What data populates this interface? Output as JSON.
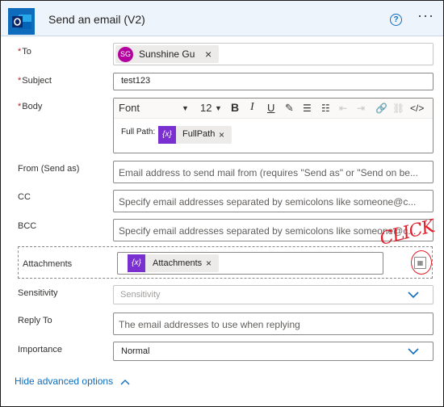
{
  "header": {
    "title": "Send an email (V2)",
    "help_icon": "help-circle-icon",
    "more_icon": "more-ellipsis-icon",
    "app_icon": "outlook-icon",
    "accent": "#0f6cbd"
  },
  "fields": {
    "to": {
      "label": "To",
      "required_mark": "*",
      "recipient": {
        "initials": "SG",
        "name": "Sunshine Gu"
      }
    },
    "subject": {
      "label": "Subject",
      "required_mark": "*",
      "value": "test123"
    },
    "body": {
      "label": "Body",
      "required_mark": "*",
      "font": "Font",
      "font_size": "12",
      "text": "Full Path:",
      "token": "FullPath",
      "token_symbol": "{x}"
    },
    "from": {
      "label": "From (Send as)",
      "placeholder": "Email address to send mail from (requires \"Send as\" or \"Send on be..."
    },
    "cc": {
      "label": "CC",
      "placeholder": "Specify email addresses separated by semicolons like someone@c..."
    },
    "bcc": {
      "label": "BCC",
      "placeholder": "Specify email addresses separated by semicolons like someone@c..."
    },
    "attachments": {
      "label": "Attachments",
      "token": "Attachments",
      "token_symbol": "{x}"
    },
    "sensitivity": {
      "label": "Sensitivity",
      "placeholder": "Sensitivity"
    },
    "reply_to": {
      "label": "Reply To",
      "placeholder": "The email addresses to use when replying"
    },
    "importance": {
      "label": "Importance",
      "value": "Normal"
    }
  },
  "footer": {
    "toggle_label": "Hide advanced options"
  },
  "annotation": {
    "text": "CLICK",
    "color": "#e11f2b"
  },
  "remove_glyph": "×"
}
